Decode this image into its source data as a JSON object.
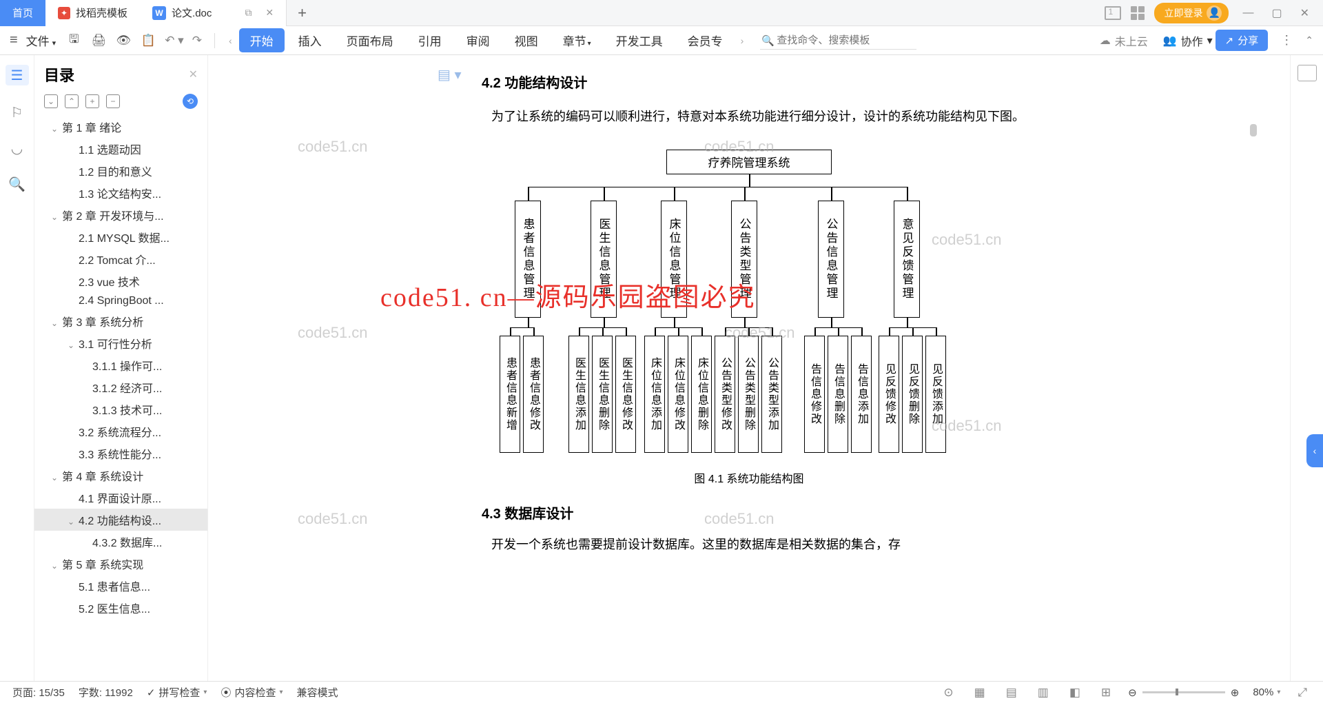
{
  "tabs": {
    "home": "首页",
    "template": "找稻壳模板",
    "doc": "论文.doc"
  },
  "login_label": "立即登录",
  "ribbon": {
    "file": "文件",
    "items": [
      "开始",
      "插入",
      "页面布局",
      "引用",
      "审阅",
      "视图",
      "章节",
      "开发工具",
      "会员专"
    ],
    "search_placeholder": "查找命令、搜索模板",
    "cloud": "未上云",
    "collab": "协作",
    "share": "分享"
  },
  "outline": {
    "title": "目录",
    "items": [
      {
        "l": 1,
        "t": "第 1 章  绪论",
        "c": true
      },
      {
        "l": 2,
        "t": "1.1 选题动因"
      },
      {
        "l": 2,
        "t": "1.2 目的和意义"
      },
      {
        "l": 2,
        "t": "1.3 论文结构安..."
      },
      {
        "l": 1,
        "t": "第 2 章  开发环境与...",
        "c": true
      },
      {
        "l": 2,
        "t": "2.1 MYSQL 数据..."
      },
      {
        "l": 2,
        "t": "2.2 Tomcat  介..."
      },
      {
        "l": 2,
        "t": "2.3 vue 技术"
      },
      {
        "l": 2,
        "t": "2.4 SpringBoot ..."
      },
      {
        "l": 1,
        "t": "第 3 章  系统分析",
        "c": true
      },
      {
        "l": 2,
        "t": "3.1 可行性分析",
        "c": true
      },
      {
        "l": 3,
        "t": "3.1.1 操作可..."
      },
      {
        "l": 3,
        "t": "3.1.2 经济可..."
      },
      {
        "l": 3,
        "t": "3.1.3 技术可..."
      },
      {
        "l": 2,
        "t": "3.2 系统流程分..."
      },
      {
        "l": 2,
        "t": "3.3 系统性能分..."
      },
      {
        "l": 1,
        "t": "第 4 章  系统设计",
        "c": true
      },
      {
        "l": 2,
        "t": "4.1 界面设计原..."
      },
      {
        "l": 2,
        "t": "4.2 功能结构设...",
        "c": true,
        "sel": true
      },
      {
        "l": 3,
        "t": "4.3.2  数据库..."
      },
      {
        "l": 1,
        "t": "第 5 章  系统实现",
        "c": true
      },
      {
        "l": 2,
        "t": "5.1 患者信息..."
      },
      {
        "l": 2,
        "t": "5.2 医生信息..."
      }
    ]
  },
  "doc": {
    "section_42": "4.2 功能结构设计",
    "para1": "为了让系统的编码可以顺利进行，特意对本系统功能进行细分设计，设计的系统功能结构见下图。",
    "diagram_root": "疗养院管理系统",
    "diagram_mids": [
      "患者信息管理",
      "医生信息管理",
      "床位信息管理",
      "公告类型管理",
      "公告信息管理",
      "意见反馈管理"
    ],
    "diagram_leaves": [
      [
        "患者信息新增",
        "患者信息修改"
      ],
      [
        "医生信息添加",
        "医生信息删除",
        "医生信息修改"
      ],
      [
        "床位信息添加",
        "床位信息修改",
        "床位信息删除"
      ],
      [
        "公告类型修改",
        "公告类型删除",
        "公告类型添加"
      ],
      [
        "告信息修改",
        "告信息删除",
        "告信息添加"
      ],
      [
        "见反馈修改",
        "见反馈删除",
        "见反馈添加"
      ]
    ],
    "caption": "图 4.1  系统功能结构图",
    "section_43": "4.3  数据库设计",
    "para2": "开发一个系统也需要提前设计数据库。这里的数据库是相关数据的集合，存"
  },
  "watermark_text": "code51.cn",
  "watermark_red": "code51. cn—源码乐园盗图必究",
  "status": {
    "page": "页面: 15/35",
    "words": "字数: 11992",
    "spell": "拼写检查",
    "content": "内容检查",
    "compat": "兼容模式",
    "zoom": "80%"
  }
}
